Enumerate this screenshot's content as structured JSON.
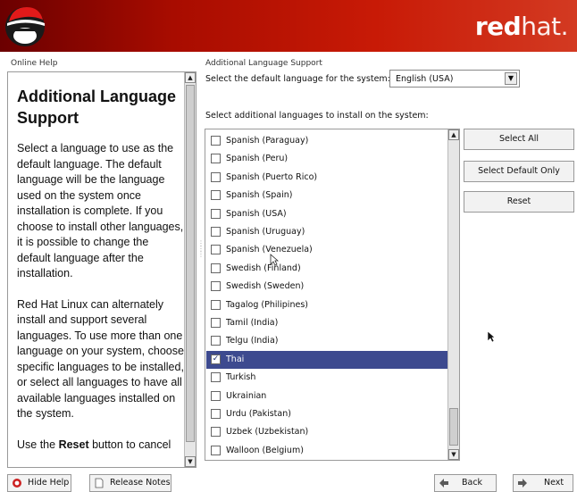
{
  "brand": {
    "bold": "red",
    "light": "hat."
  },
  "help": {
    "panel_title": "Online Help",
    "heading": "Additional Language Support",
    "paragraphs": [
      "Select a language to use as the default language. The default language will be the language used on the system once installation is complete. If you choose to install other languages, it is possible to change the default language after the installation.",
      "Red Hat Linux can alternately install and support several languages. To use more than one language on your system, choose specific languages to be installed, or select all languages to have all available languages installed on the system."
    ],
    "cut_para_pre": "Use the ",
    "cut_para_bold": "Reset",
    "cut_para_post": " button to cancel"
  },
  "main": {
    "section_title": "Additional Language Support",
    "default_label": "Select the default language for the system:",
    "default_value": "English (USA)",
    "additional_label": "Select additional languages to install on the system:"
  },
  "languages": [
    {
      "label": "Spanish (Paraguay)",
      "checked": false
    },
    {
      "label": "Spanish (Peru)",
      "checked": false
    },
    {
      "label": "Spanish (Puerto Rico)",
      "checked": false
    },
    {
      "label": "Spanish (Spain)",
      "checked": false
    },
    {
      "label": "Spanish (USA)",
      "checked": false
    },
    {
      "label": "Spanish (Uruguay)",
      "checked": false
    },
    {
      "label": "Spanish (Venezuela)",
      "checked": false
    },
    {
      "label": "Swedish (Finland)",
      "checked": false
    },
    {
      "label": "Swedish (Sweden)",
      "checked": false
    },
    {
      "label": "Tagalog (Philipines)",
      "checked": false
    },
    {
      "label": "Tamil (India)",
      "checked": false
    },
    {
      "label": "Telgu (India)",
      "checked": false
    },
    {
      "label": "Thai",
      "checked": true
    },
    {
      "label": "Turkish",
      "checked": false
    },
    {
      "label": "Ukrainian",
      "checked": false
    },
    {
      "label": "Urdu (Pakistan)",
      "checked": false
    },
    {
      "label": "Uzbek (Uzbekistan)",
      "checked": false
    },
    {
      "label": "Walloon (Belgium)",
      "checked": false
    }
  ],
  "selected_index": 12,
  "buttons": {
    "select_all": "Select All",
    "select_default_only": "Select Default Only",
    "reset": "Reset"
  },
  "footer": {
    "hide_help": "Hide Help",
    "release_notes": "Release Notes",
    "back": "Back",
    "next": "Next"
  },
  "colors": {
    "header_dark": "#6b0000",
    "header_light": "#d33a22",
    "selection": "#3d4a8f"
  }
}
